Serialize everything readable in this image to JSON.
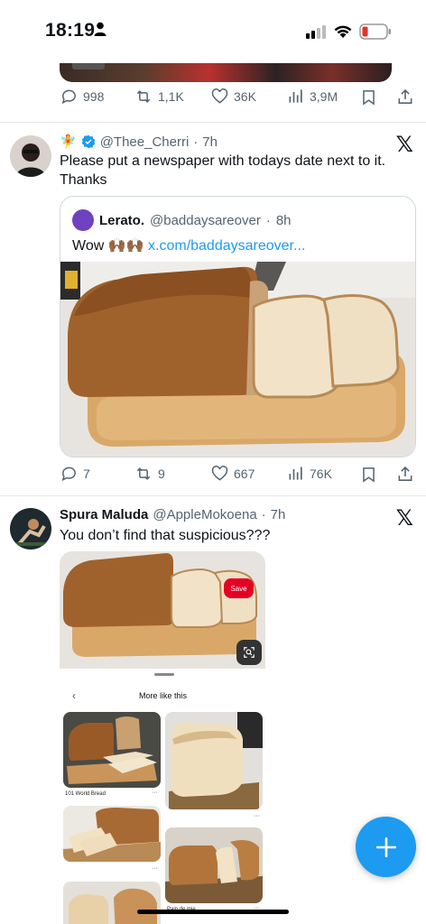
{
  "status_bar": {
    "time": "18:19"
  },
  "tweet0": {
    "stats": {
      "replies": "998",
      "reposts": "1,1K",
      "likes": "36K",
      "views": "3,9M"
    }
  },
  "tweet1": {
    "handle": "@Thee_Cherri",
    "time": "7h",
    "text": "Please put a newspaper with todays date next to it. Thanks",
    "quote": {
      "name": "Lerato.",
      "handle": "@baddaysareover",
      "time": "8h",
      "text": "Wow",
      "emoji": "🙌🏾🙌🏾",
      "link": "x.com/baddaysareover..."
    },
    "stats": {
      "replies": "7",
      "reposts": "9",
      "likes": "667",
      "views": "76K"
    }
  },
  "tweet2": {
    "name": "Spura Maluda",
    "handle": "@AppleMokoena",
    "time": "7h",
    "text": "You don’t find that suspicious???",
    "media": {
      "save_label": "Save",
      "sheet_title": "More like this",
      "pin1_label": "101 World Bread",
      "pin2_label": "Pain de mie",
      "dots": "···"
    }
  },
  "separators": {
    "dot": "·"
  },
  "colors": {
    "accent": "#1d9bf0",
    "muted": "#536471",
    "verified": "#1d9bf0",
    "save_red": "#e60023"
  },
  "icons": [
    "person-icon",
    "signal-icon",
    "wifi-icon",
    "battery-icon",
    "reply-icon",
    "repost-icon",
    "like-icon",
    "views-icon",
    "bookmark-icon",
    "share-icon",
    "x-logo-icon",
    "verified-badge-icon",
    "fairy-emoji-icon",
    "plus-icon",
    "lens-icon",
    "back-chevron-icon"
  ]
}
